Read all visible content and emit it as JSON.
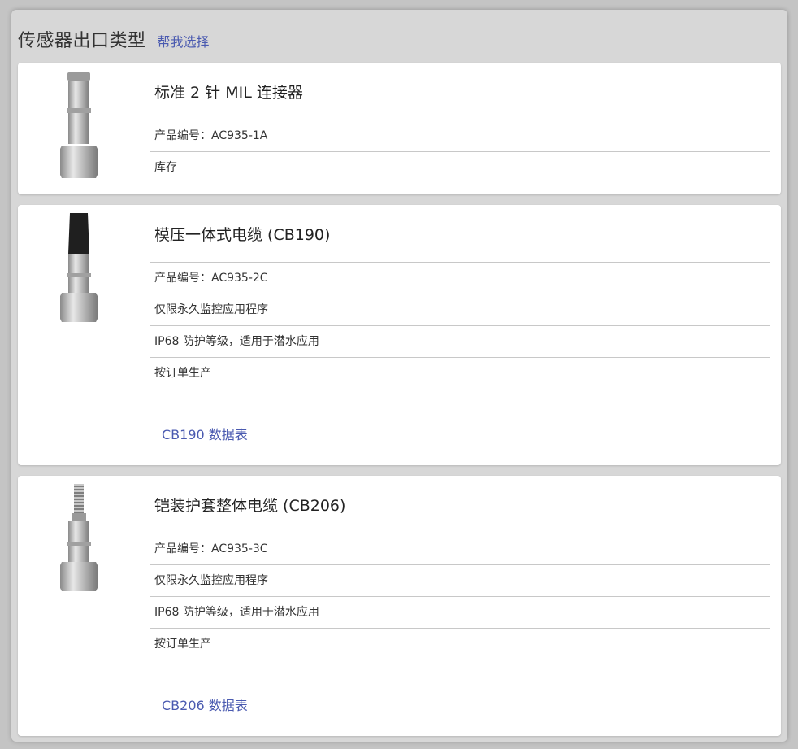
{
  "header": {
    "title": "传感器出口类型",
    "help_link": "帮我选择"
  },
  "cards": [
    {
      "title": "标准 2 针 MIL 连接器",
      "rows": [
        "产品编号：AC935-1A",
        "库存"
      ],
      "link": ""
    },
    {
      "title": "模压一体式电缆 (CB190)",
      "rows": [
        "产品编号：AC935-2C",
        "仅限永久监控应用程序",
        "IP68 防护等级，适用于潜水应用",
        "按订单生产"
      ],
      "link": "CB190 数据表"
    },
    {
      "title": "铠装护套整体电缆 (CB206)",
      "rows": [
        "产品编号：AC935-3C",
        "仅限永久监控应用程序",
        "IP68 防护等级，适用于潜水应用",
        "按订单生产"
      ],
      "link": "CB206 数据表"
    }
  ],
  "colors": {
    "link": "#4a5ab0",
    "panel": "#d7d7d7"
  }
}
